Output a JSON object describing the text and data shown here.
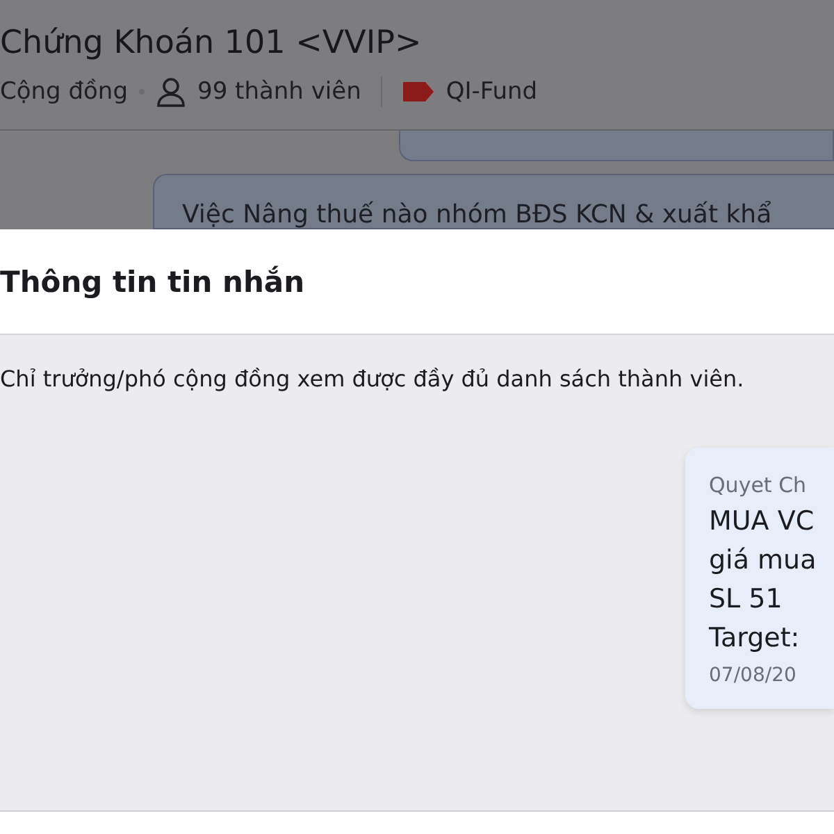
{
  "group": {
    "title": "Chứng Khoán 101 <VVIP>",
    "type": "Cộng đồng",
    "members": "99 thành viên",
    "tag": "QI-Fund"
  },
  "background_message": {
    "text": "Việc Nâng thuế nào nhóm BĐS KCN & xuất khẩ"
  },
  "sheet": {
    "title": "Thông tin tin nhắn",
    "notice": "Chỉ trưởng/phó cộng đồng xem được đầy đủ danh sách thành viên.",
    "message": {
      "sender": "Quyet Ch",
      "lines": [
        "MUA VC",
        "giá mua",
        "SL 51",
        "Target:"
      ],
      "time": "07/08/20"
    }
  }
}
